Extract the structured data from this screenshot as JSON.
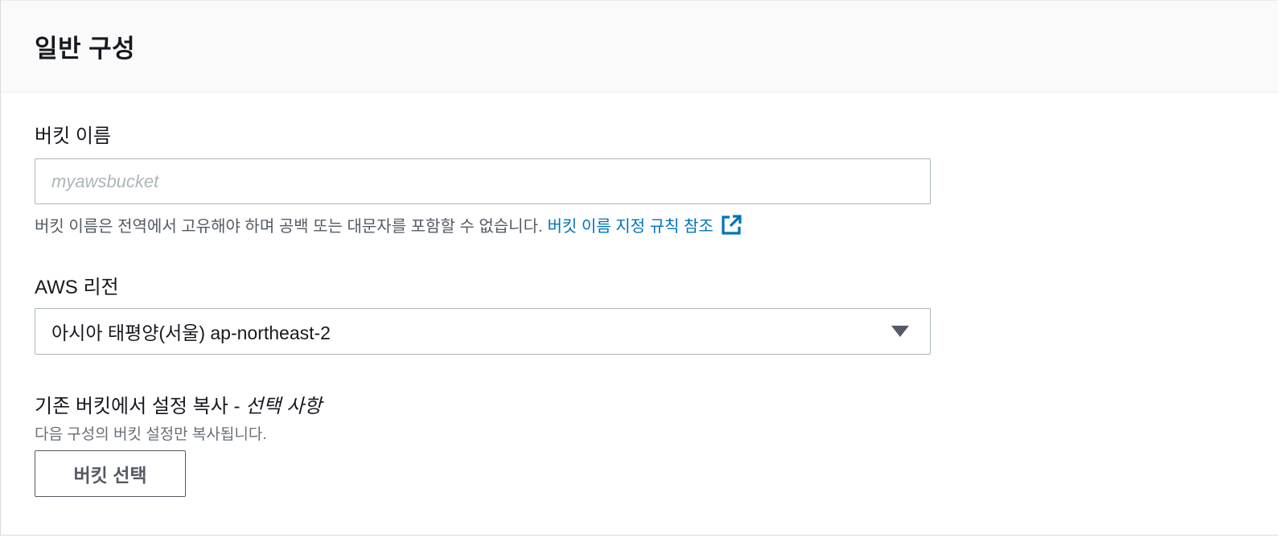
{
  "section": {
    "title": "일반 구성"
  },
  "bucket_name": {
    "label": "버킷 이름",
    "placeholder": "myawsbucket",
    "value": "",
    "hint": "버킷 이름은 전역에서 고유해야 하며 공백 또는 대문자를 포함할 수 없습니다.",
    "hint_link": "버킷 이름 지정 규칙 참조",
    "hint_link_icon": "external-link-icon"
  },
  "region": {
    "label": "AWS 리전",
    "selected": "아시아 태평양(서울) ap-northeast-2",
    "caret_icon": "caret-down-icon"
  },
  "copy_settings": {
    "label": "기존 버킷에서 설정 복사 - ",
    "label_optional": "선택 사항",
    "description": "다음 구성의 버킷 설정만 복사됩니다.",
    "button_label": "버킷 선택"
  },
  "colors": {
    "link": "#0073bb",
    "border": "#aab7b8",
    "header_bg": "#fafafa",
    "text": "#16191f",
    "secondary_text": "#545b64"
  }
}
